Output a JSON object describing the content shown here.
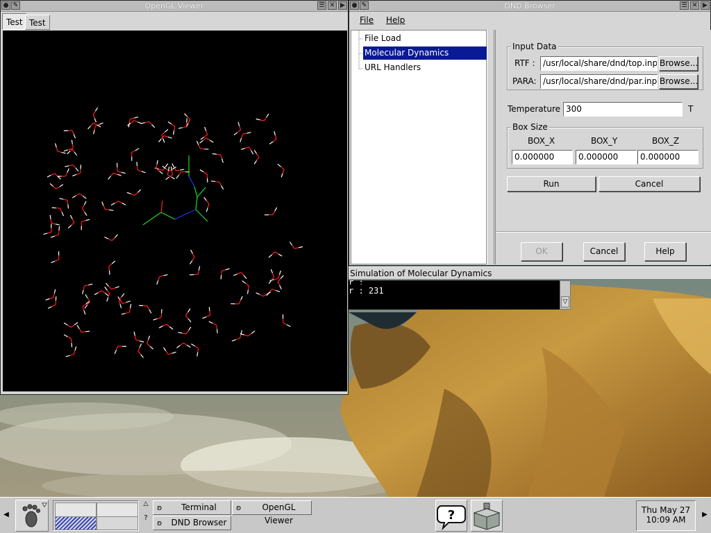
{
  "opengl_viewer": {
    "title": "OpenGL Viewer",
    "tabs": [
      "Test",
      "Test"
    ]
  },
  "dnd_browser": {
    "title": "DND Browser",
    "menu": [
      "File",
      "Help"
    ],
    "tree": [
      "File Load",
      "Molecular Dynamics",
      "URL Handlers"
    ],
    "selected_tree_item": "Molecular Dynamics",
    "input_data": {
      "legend": "Input Data",
      "rtf_label": "RTF :",
      "rtf_value": "/usr/local/share/dnd/top.inp",
      "para_label": "PARA:",
      "para_value": "/usr/local/share/dnd/par.inp",
      "browse_label": "Browse..."
    },
    "temperature": {
      "label": "Temperature :",
      "value": "300",
      "unit": "T"
    },
    "box_size": {
      "legend": "Box Size",
      "headers": [
        "BOX_X",
        "BOX_Y",
        "BOX_Z"
      ],
      "values": [
        "0.000000",
        "0.000000",
        "0.000000"
      ]
    },
    "run_label": "Run",
    "cancel_label": "Cancel",
    "dialog_buttons": {
      "ok": "OK",
      "cancel": "Cancel",
      "help": "Help"
    }
  },
  "simulation": {
    "title": "Simulation of Molecular Dynamics",
    "line1": "r :",
    "line2": "r : 231"
  },
  "taskbar": {
    "tasks": [
      "Terminal",
      "OpenGL Viewer",
      "DND Browser"
    ],
    "pager_hint": "?",
    "clock_date": "Thu May 27",
    "clock_time": "10:09 AM"
  },
  "icons": {
    "foot": "gnome-foot-icon",
    "help": "help-speech-icon",
    "toolbox": "toolbox-icon"
  },
  "colors": {
    "selection": "#0a1a94",
    "titlebar": "#bcbcbc",
    "window_bg": "#d6d6d6"
  }
}
